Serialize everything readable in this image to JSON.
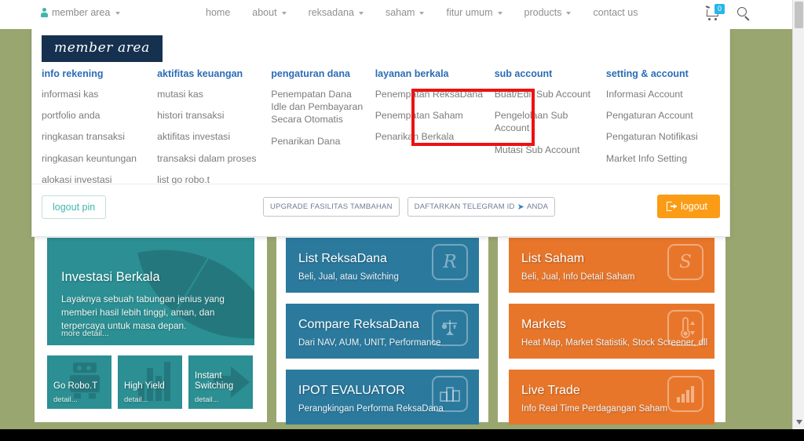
{
  "topnav": {
    "member_area": "member area",
    "member_icon": "person-icon",
    "items": [
      {
        "label": "home",
        "has_caret": false
      },
      {
        "label": "about",
        "has_caret": true
      },
      {
        "label": "reksadana",
        "has_caret": true
      },
      {
        "label": "saham",
        "has_caret": true
      },
      {
        "label": "fitur umum",
        "has_caret": true
      },
      {
        "label": "products",
        "has_caret": true
      },
      {
        "label": "contact us",
        "has_caret": false
      }
    ],
    "cart_icon": "shopping-cart-icon",
    "cart_count": "0",
    "search_icon": "search-icon"
  },
  "dropdown": {
    "badge": "member area",
    "columns": [
      {
        "header": "info rekening",
        "items": [
          "informasi kas",
          "portfolio anda",
          "ringkasan transaksi",
          "ringkasan keuntungan",
          "alokasi investasi"
        ]
      },
      {
        "header": "aktifitas keuangan",
        "items": [
          "mutasi kas",
          "histori transaksi",
          "aktifitas investasi",
          "transaksi dalam proses",
          "list go robo.t"
        ]
      },
      {
        "header": "pengaturan dana",
        "items": [
          "Penempatan Dana Idle dan Pembayaran Secara Otomatis",
          "Penarikan Dana"
        ]
      },
      {
        "header": "layanan berkala",
        "items": [
          "Penempatan ReksaDana",
          "Penempatan Saham",
          "Penarikan Berkala"
        ]
      },
      {
        "header": "sub account",
        "items": [
          "Buat/Edit Sub Account",
          "Pengelolaan Sub Account",
          "Mutasi Sub Account"
        ]
      },
      {
        "header": "setting & account",
        "items": [
          "Informasi Account",
          "Pengaturan Account",
          "Pengaturan Notifikasi",
          "Market Info Setting"
        ]
      }
    ],
    "footer": {
      "logout_pin": "logout pin",
      "upgrade": "UPGRADE FASILITAS TAMBAHAN",
      "telegram_pre": "DAFTARKAN TELEGRAM ID",
      "telegram_glyph": "➤",
      "telegram_post": "ANDA",
      "logout": "logout",
      "logout_icon": "sign-out-icon"
    },
    "highlight_color": "#ee1111",
    "header_color": "#2b6cb5",
    "badge_bg": "#16314f"
  },
  "content": {
    "hero": {
      "title": "Investasi Berkala",
      "body": "Layaknya sebuah tabungan jenius yang memberi hasil lebih tinggi, aman, dan terpercaya untuk masa depan.",
      "more": "more detail...",
      "icon": "leaf-icon",
      "color": "#2b8f93"
    },
    "minis": [
      {
        "label": "Go Robo.T",
        "detail": "detail...",
        "icon": "robot-icon"
      },
      {
        "label": "High Yield",
        "detail": "detail...",
        "icon": "bar-chart-icon"
      },
      {
        "label": "Instant Switching",
        "detail": "detail...",
        "icon": "arrow-right-icon"
      }
    ],
    "blue_cards": [
      {
        "title": "List ReksaDana",
        "subtitle": "Beli, Jual, atau Switching",
        "icon": "r-letter-icon"
      },
      {
        "title": "Compare ReksaDana",
        "subtitle": "Dari NAV, AUM, UNIT, Performance",
        "icon": "balance-scale-icon"
      },
      {
        "title": "IPOT EVALUATOR",
        "subtitle": "Perangkingan Performa ReksaDana",
        "icon": "ranking-podium-icon"
      }
    ],
    "orange_cards": [
      {
        "title": "List Saham",
        "subtitle": "Beli, Jual, Info Detail Saham",
        "icon": "s-letter-icon"
      },
      {
        "title": "Markets",
        "subtitle": "Heat Map, Market Statistik, Stock Screener, dll",
        "icon": "thermometer-icon"
      },
      {
        "title": "Live Trade",
        "subtitle": "Info Real Time Perdagangan Saham",
        "icon": "bar-chart-icon"
      }
    ],
    "blue_color": "#2b7a9e",
    "orange_color": "#e8762a",
    "page_bg": "#99a66f"
  }
}
